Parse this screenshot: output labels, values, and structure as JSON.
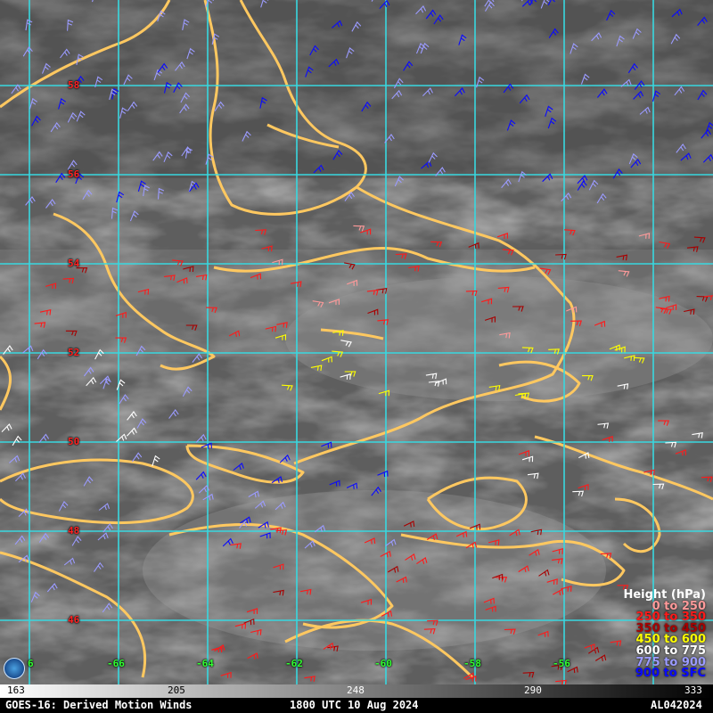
{
  "map": {
    "latitude_labels": [
      "58",
      "56",
      "54",
      "52",
      "50",
      "48",
      "46"
    ],
    "longitude_labels": [
      "-66",
      "-64",
      "-62",
      "-60",
      "-58",
      "-56"
    ],
    "partial_longitude_label": "6",
    "grid_color": "#38d8e0",
    "coast_color": "#ffc860"
  },
  "legend": {
    "title": "Height (hPa)",
    "items": [
      {
        "label": "0 to 250",
        "color": "#ff9a9a"
      },
      {
        "label": "250 to 350",
        "color": "#ff1a1a"
      },
      {
        "label": "350 to 450",
        "color": "#a80000"
      },
      {
        "label": "450 to 600",
        "color": "#ffff00"
      },
      {
        "label": "600 to 775",
        "color": "#ffffff"
      },
      {
        "label": "775 to 900",
        "color": "#9b9bff"
      },
      {
        "label": "900 to SFC",
        "color": "#0a0aff"
      }
    ]
  },
  "colorbar": {
    "ticks": [
      "163",
      "205",
      "248",
      "290",
      "333"
    ]
  },
  "footer": {
    "left": "GOES-16: Derived Motion Winds",
    "center": "1800 UTC 10 Aug 2024",
    "right": "AL042024"
  }
}
